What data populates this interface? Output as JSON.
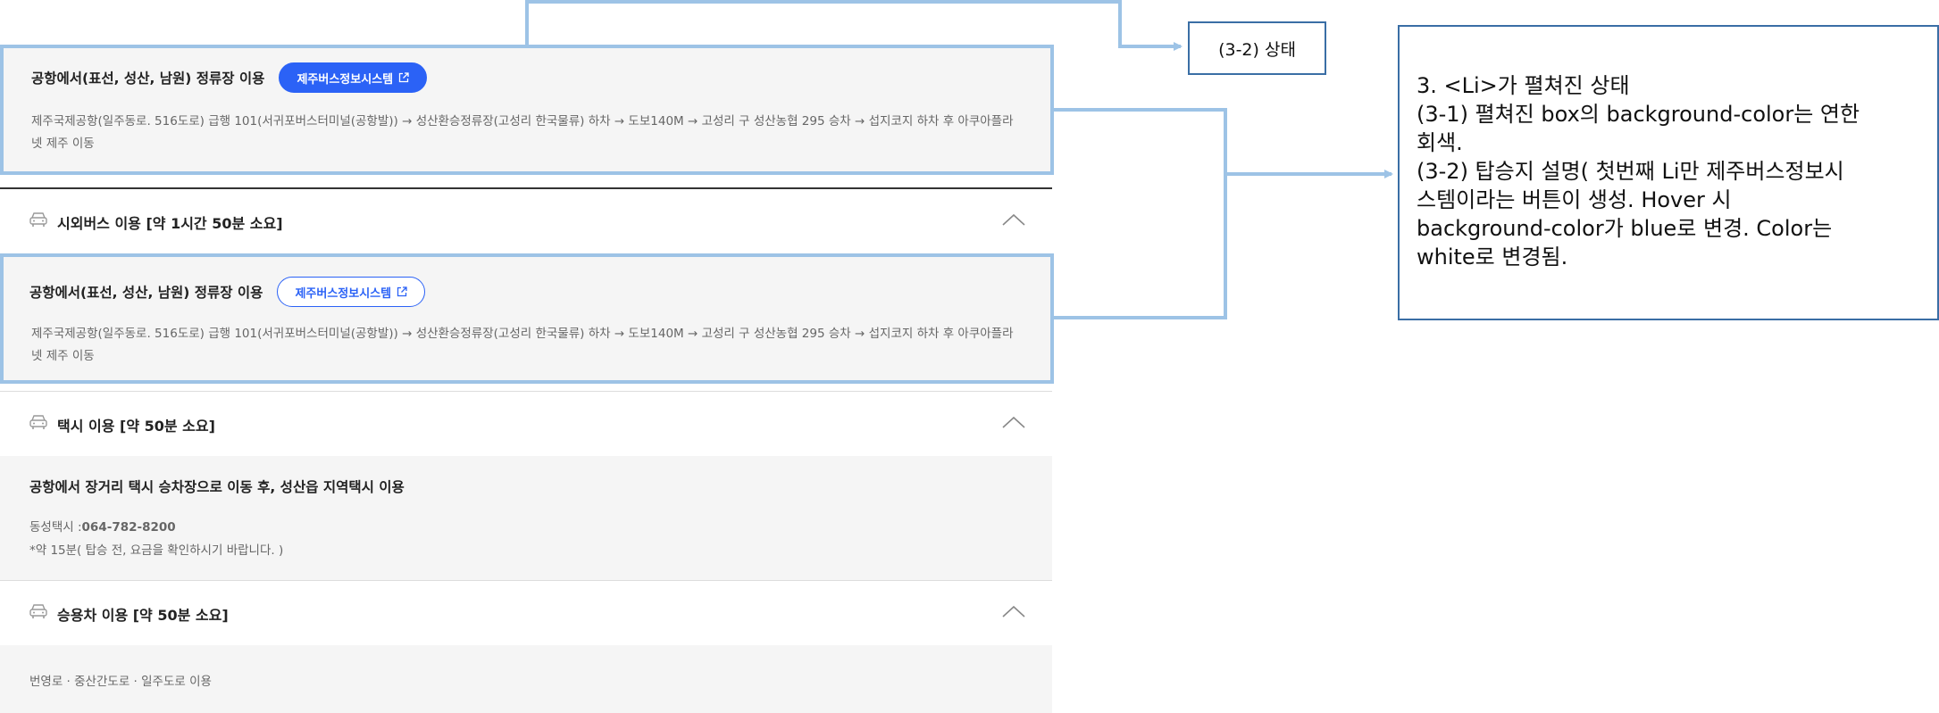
{
  "routes": [
    {
      "title": "공항에서(표선, 성산, 남원) 정류장 이용",
      "button_label": "제주버스정보시스템",
      "button_style": "filled",
      "desc": "제주국제공항(일주동로. 516도로) 급행 101(서귀포버스터미널(공항발)) → 성산환승정류장(고성리 한국물류) 하차 → 도보140M → 고성리 구 성산농협 295 승차 → 섭지코지 하차 후 아쿠아플라넷 제주 이동"
    },
    {
      "title": "공항에서(표선, 성산, 남원) 정류장 이용",
      "button_label": "제주버스정보시스템",
      "button_style": "outline",
      "desc": "제주국제공항(일주동로. 516도로) 급행 101(서귀포버스터미널(공항발)) → 성산환승정류장(고성리 한국물류) 하차 → 도보140M → 고성리 구 성산농협 295 승차 → 섭지코지 하차 후 아쿠아플라넷 제주 이동"
    }
  ],
  "sections": {
    "intercity_bus": {
      "label": "시외버스 이용 [약 1시간 50분 소요]",
      "icon": "car-icon"
    },
    "taxi": {
      "label": "택시 이용 [약 50분 소요]",
      "icon": "car-icon",
      "title": "공항에서 장거리 택시 승차장으로 이동 후, 성산읍 지역택시 이용",
      "phone_label": "동성택시 :",
      "phone": "064-782-8200",
      "note": "*약 15분( 탑승 전, 요금을 확인하시기 바랍니다. )"
    },
    "car": {
      "label": "승용차 이용 [약 50분 소요]",
      "icon": "car-icon",
      "route": "번영로 · 중산간도로 · 일주도로 이용"
    }
  },
  "annotations": {
    "state_label": "(3-2) 상태",
    "note_lines": [
      "3. <Li>가 펼쳐진 상태",
      "(3-1) 펼쳐진 box의 background-color는 연한",
      "회색.",
      "(3-2) 탑승지 설명( 첫번째 Li만 제주버스정보시",
      "스템이라는 버튼이 생성. Hover 시",
      "background-color가 blue로 변경. Color는",
      "white로 변경됨."
    ]
  },
  "colors": {
    "accent": "#2b62f6",
    "box_bg": "#f5f5f5",
    "highlight": "#9dc3e6",
    "annotation_border": "#3a6ea5",
    "desc_text": "#666666"
  }
}
